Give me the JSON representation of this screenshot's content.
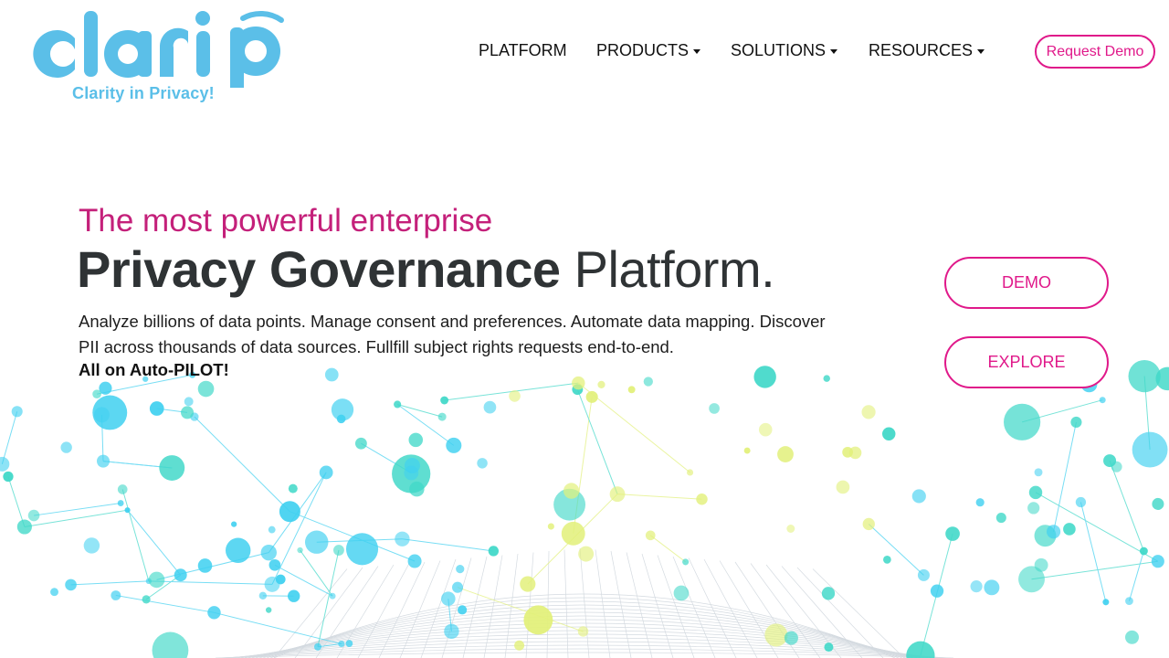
{
  "brand": {
    "logo_text": "clarip",
    "tagline": "Clarity in Privacy!",
    "logo_color": "#5bbfe8"
  },
  "nav": {
    "items": [
      {
        "label": "PLATFORM",
        "dropdown": false
      },
      {
        "label": "PRODUCTS",
        "dropdown": true
      },
      {
        "label": "SOLUTIONS",
        "dropdown": true
      },
      {
        "label": "RESOURCES",
        "dropdown": true
      }
    ],
    "request_demo_label": "Request Demo"
  },
  "hero": {
    "kicker": "The most powerful enterprise",
    "title_bold": "Privacy Governance",
    "title_light": "Platform.",
    "description": "Analyze billions of data points. Manage consent and preferences. Automate data mapping. Discover PII across thousands of data sources. Fullfill subject rights requests end-to-end.",
    "emphasis": "All on Auto-PILOT!"
  },
  "cta": {
    "demo_label": "DEMO",
    "explore_label": "EXPLORE"
  },
  "colors": {
    "accent": "#e0198a",
    "kicker": "#c4207a",
    "title": "#2f3335",
    "network_blue": "#3fd0f0",
    "network_teal": "#40d8c8",
    "network_yellow": "#e2f07a"
  }
}
